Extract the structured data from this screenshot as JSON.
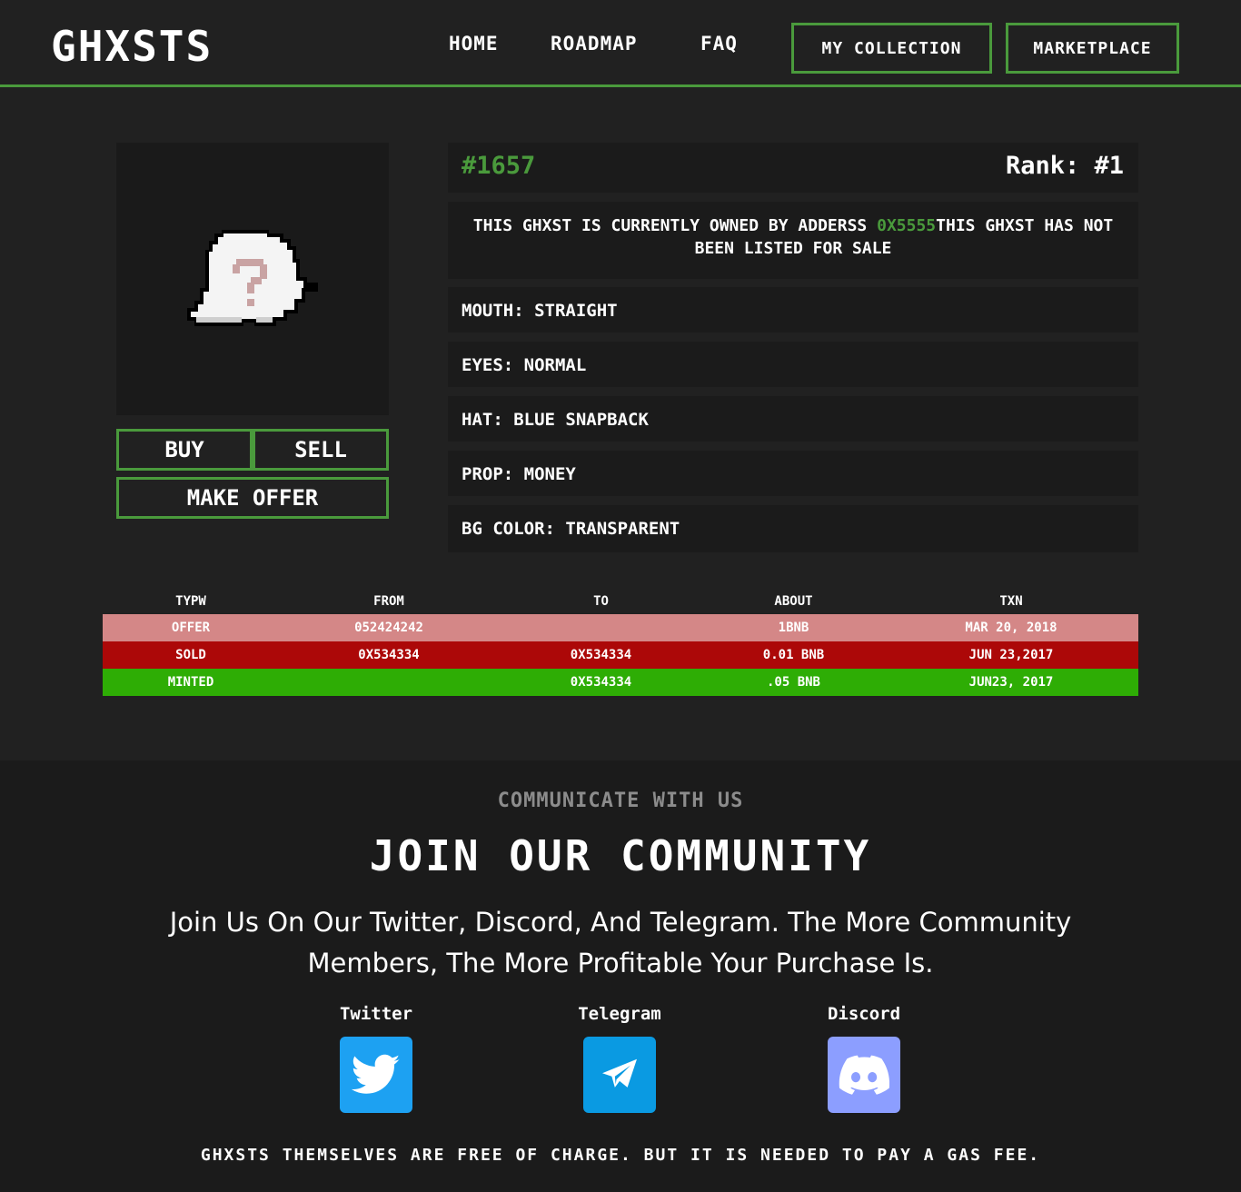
{
  "header": {
    "logo": "GHXSTS",
    "nav": {
      "home": "HOME",
      "roadmap": "ROADMAP",
      "faq": "FAQ"
    },
    "buttons": {
      "my_collection": "MY COLLECTION",
      "marketplace": "MARKETPLACE"
    },
    "accent_color": "#4a9a3c"
  },
  "item": {
    "id": "#1657",
    "rank": "Rank: #1",
    "owner_prefix": "THIS GHXST IS CURRENTLY OWNED BY ADDERSS ",
    "owner_address": "0X5555",
    "owner_suffix": "THIS GHXST HAS NOT BEEN LISTED FOR SALE",
    "image_icon": "ghost-question-icon",
    "traits": [
      {
        "label": "MOUTH: STRAIGHT"
      },
      {
        "label": "EYES: NORMAL"
      },
      {
        "label": "HAT: BLUE SNAPBACK"
      },
      {
        "label": "PROP: MONEY"
      },
      {
        "label": "BG COLOR: TRANSPARENT"
      }
    ]
  },
  "actions": {
    "buy": "BUY",
    "sell": "SELL",
    "make_offer": "MAKE OFFER"
  },
  "transactions": {
    "headers": [
      "TYPW",
      "FROM",
      "TO",
      "ABOUT",
      "TXN"
    ],
    "rows": [
      {
        "type": "OFFER",
        "from": "052424242",
        "to": "",
        "about": "1BNB",
        "txn": "MAR 20, 2018",
        "color": "#d48787"
      },
      {
        "type": "SOLD",
        "from": "0X534334",
        "to": "0X534334",
        "about": "0.01 BNB",
        "txn": "JUN 23,2017",
        "color": "#ac0808"
      },
      {
        "type": "MINTED",
        "from": "",
        "to": "0X534334",
        "about": ".05 BNB",
        "txn": "JUN23, 2017",
        "color": "#2ead05"
      }
    ]
  },
  "footer": {
    "eyebrow": "COMMUNICATE WITH US",
    "title": "JOIN OUR COMMUNITY",
    "description": "Join Us On Our Twitter, Discord, And Telegram. The More Community Members, The More Profitable Your Purchase Is.",
    "socials": [
      {
        "label": "Twitter",
        "icon": "twitter-icon",
        "color": "#1da1f2"
      },
      {
        "label": "Telegram",
        "icon": "telegram-icon",
        "color": "#0088cc"
      },
      {
        "label": "Discord",
        "icon": "discord-icon",
        "color": "#8c9eff"
      }
    ],
    "note": "GHXSTS THEMSELVES ARE FREE OF CHARGE. BUT IT IS NEEDED TO PAY A GAS FEE."
  }
}
